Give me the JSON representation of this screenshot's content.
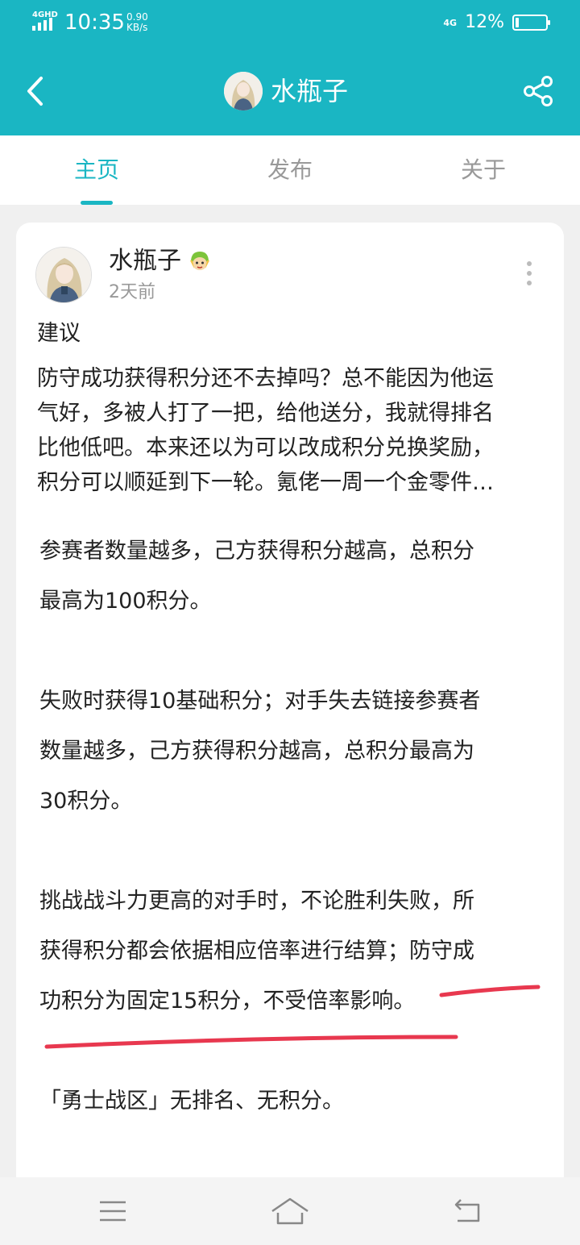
{
  "status_bar": {
    "network": "4GHD",
    "time": "10:35",
    "speed_value": "0.90",
    "speed_unit": "KB/s",
    "network_right": "4G",
    "battery_percent": "12%",
    "battery_level": 0.12
  },
  "header": {
    "title": "水瓶子",
    "accent_color": "#1ab6c3"
  },
  "tabs": [
    {
      "label": "主页",
      "active": true
    },
    {
      "label": "发布",
      "active": false
    },
    {
      "label": "关于",
      "active": false
    }
  ],
  "post": {
    "author": "水瓶子",
    "time": "2天前",
    "title": "建议",
    "body_lines": [
      "防守成功获得积分还不去掉吗？总不能因为他运",
      "气好，多被人打了一把，给他送分，我就得排名",
      "比他低吧。本来还以为可以改成积分兑换奖励，",
      "积分可以顺延到下一轮。氪佬一周一个金零件…"
    ]
  },
  "content_paragraphs": [
    [
      "参赛者数量越多，己方获得积分越高，总积分",
      "最高为100积分。"
    ],
    [
      "失败时获得10基础积分；对手失去链接参赛者",
      "数量越多，己方获得积分越高，总积分最高为",
      "30积分。"
    ],
    [
      "挑战战斗力更高的对手时，不论胜利失败，所",
      "获得积分都会依据相应倍率进行结算；防守成",
      "功积分为固定15积分，不受倍率影响。"
    ],
    [
      "「勇士战区」无排名、无积分。"
    ]
  ],
  "icons": {
    "back": "back-arrow-icon",
    "share": "share-icon",
    "more": "more-vertical-icon",
    "menu": "menu-icon",
    "home": "home-icon",
    "return": "return-icon"
  },
  "annotation_color": "#e8384f"
}
